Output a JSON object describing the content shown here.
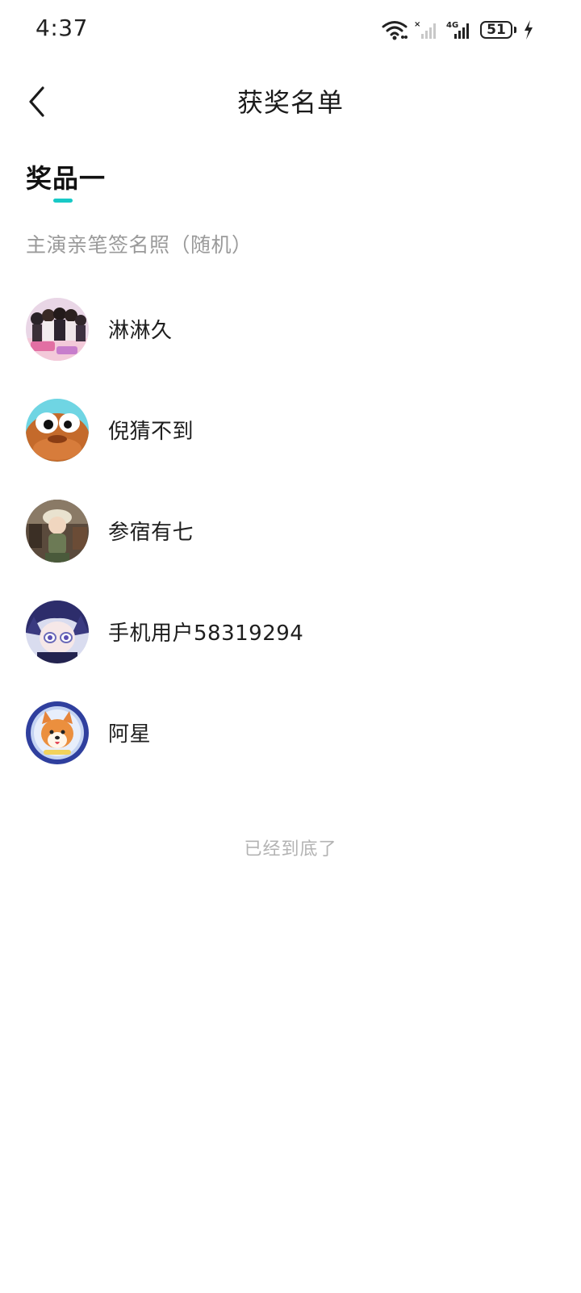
{
  "status_bar": {
    "time": "4:37",
    "battery_level": "51",
    "icons": [
      "wifi-icon",
      "signal-no-sim-icon",
      "signal-4g-icon",
      "battery-icon",
      "charging-icon"
    ]
  },
  "header": {
    "title": "获奖名单",
    "back_icon": "chevron-left-icon"
  },
  "prize": {
    "tab_label": "奖品一",
    "description": "主演亲笔签名照（随机）",
    "accent_color": "#18c9c6"
  },
  "winners": [
    {
      "name": "淋淋久",
      "avatar": "group-photo-avatar"
    },
    {
      "name": "倪猜不到",
      "avatar": "cartoon-duck-avatar"
    },
    {
      "name": "参宿有七",
      "avatar": "figurine-avatar"
    },
    {
      "name": "手机用户58319294",
      "avatar": "anime-character-avatar"
    },
    {
      "name": "阿星",
      "avatar": "shiba-dog-avatar"
    }
  ],
  "footer": {
    "end_text": "已经到底了"
  }
}
